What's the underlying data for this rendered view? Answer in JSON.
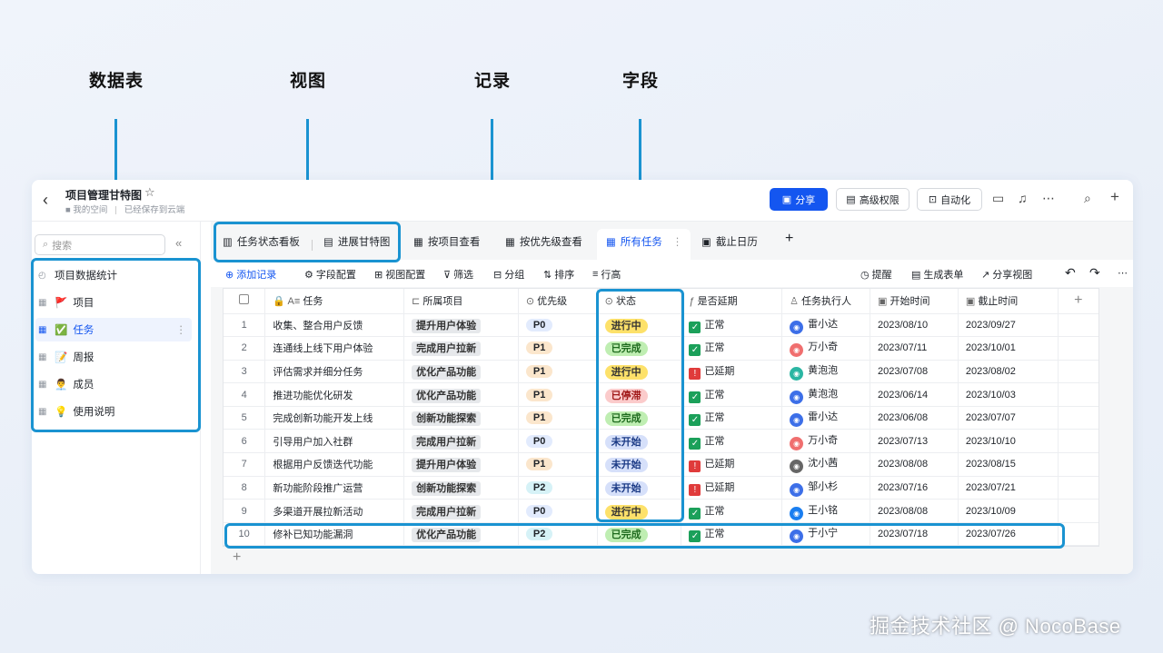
{
  "annotations": {
    "table": "数据表",
    "view": "视图",
    "record": "记录",
    "field": "字段"
  },
  "header": {
    "title": "项目管理甘特图",
    "location": "我的空间",
    "save_status": "已经保存到云端",
    "share": "分享",
    "permissions": "高级权限",
    "automation": "自动化"
  },
  "sidebar": {
    "search_placeholder": "搜索",
    "items": [
      {
        "label": "项目数据统计",
        "emoji": ""
      },
      {
        "label": "项目",
        "emoji": "🚩"
      },
      {
        "label": "任务",
        "emoji": "✅"
      },
      {
        "label": "周报",
        "emoji": "📝"
      },
      {
        "label": "成员",
        "emoji": "👨‍💼"
      },
      {
        "label": "使用说明",
        "emoji": "💡"
      }
    ]
  },
  "tabs": [
    "任务状态看板",
    "进展甘特图",
    "按项目查看",
    "按优先级查看",
    "所有任务",
    "截止日历"
  ],
  "toolbar": {
    "add_record": "添加记录",
    "field_config": "字段配置",
    "view_config": "视图配置",
    "filter": "筛选",
    "group": "分组",
    "sort": "排序",
    "row_height": "行高",
    "remind": "提醒",
    "form": "生成表单",
    "share_view": "分享视图"
  },
  "columns": [
    "任务",
    "所属项目",
    "优先级",
    "状态",
    "是否延期",
    "任务执行人",
    "开始时间",
    "截止时间"
  ],
  "rows": [
    {
      "n": "1",
      "task": "收集、整合用户反馈",
      "project": "提升用户体验",
      "priority": "P0",
      "status": "进行中",
      "delay": "正常",
      "owner": "雷小达",
      "start": "2023/08/10",
      "end": "2023/09/27"
    },
    {
      "n": "2",
      "task": "连通线上线下用户体验",
      "project": "完成用户拉新",
      "priority": "P1",
      "status": "已完成",
      "delay": "正常",
      "owner": "万小奇",
      "start": "2023/07/11",
      "end": "2023/10/01"
    },
    {
      "n": "3",
      "task": "评估需求并细分任务",
      "project": "优化产品功能",
      "priority": "P1",
      "status": "进行中",
      "delay": "已延期",
      "owner": "黄泡泡",
      "start": "2023/07/08",
      "end": "2023/08/02"
    },
    {
      "n": "4",
      "task": "推进功能优化研发",
      "project": "优化产品功能",
      "priority": "P1",
      "status": "已停滞",
      "delay": "正常",
      "owner": "黄泡泡",
      "start": "2023/06/14",
      "end": "2023/10/03"
    },
    {
      "n": "5",
      "task": "完成创新功能开发上线",
      "project": "创新功能探索",
      "priority": "P1",
      "status": "已完成",
      "delay": "正常",
      "owner": "雷小达",
      "start": "2023/06/08",
      "end": "2023/07/07"
    },
    {
      "n": "6",
      "task": "引导用户加入社群",
      "project": "完成用户拉新",
      "priority": "P0",
      "status": "未开始",
      "delay": "正常",
      "owner": "万小奇",
      "start": "2023/07/13",
      "end": "2023/10/10"
    },
    {
      "n": "7",
      "task": "根据用户反馈迭代功能",
      "project": "提升用户体验",
      "priority": "P1",
      "status": "未开始",
      "delay": "已延期",
      "owner": "沈小茜",
      "start": "2023/08/08",
      "end": "2023/08/15"
    },
    {
      "n": "8",
      "task": "新功能阶段推广运营",
      "project": "创新功能探索",
      "priority": "P2",
      "status": "未开始",
      "delay": "已延期",
      "owner": "邹小杉",
      "start": "2023/07/16",
      "end": "2023/07/21"
    },
    {
      "n": "9",
      "task": "多渠道开展拉新活动",
      "project": "完成用户拉新",
      "priority": "P0",
      "status": "进行中",
      "delay": "正常",
      "owner": "王小铭",
      "start": "2023/08/08",
      "end": "2023/10/09"
    },
    {
      "n": "10",
      "task": "修补已知功能漏洞",
      "project": "优化产品功能",
      "priority": "P2",
      "status": "已完成",
      "delay": "正常",
      "owner": "于小宁",
      "start": "2023/07/18",
      "end": "2023/07/26"
    }
  ],
  "colors": {
    "accent": "#1456f0",
    "highlight": "#1a93d1"
  },
  "watermark": "掘金技术社区 @ NocoBase"
}
